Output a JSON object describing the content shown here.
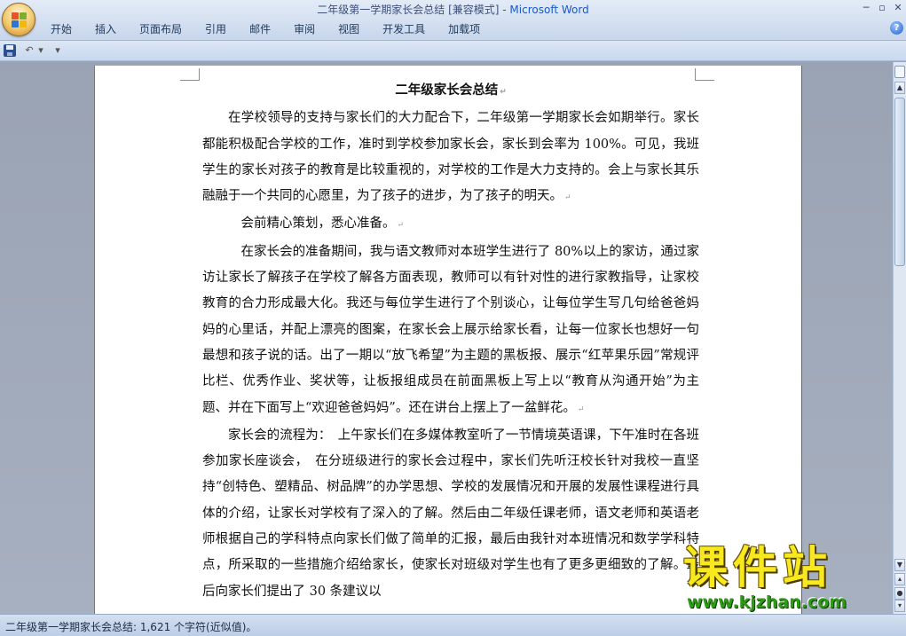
{
  "window": {
    "title_doc": "二年级第一学期家长会总结 [兼容模式] - ",
    "title_app": "Microsoft Word",
    "controls": [
      "─",
      "▫",
      "✕"
    ]
  },
  "ribbon": {
    "tabs": [
      "开始",
      "插入",
      "页面布局",
      "引用",
      "邮件",
      "审阅",
      "视图",
      "开发工具",
      "加载项"
    ],
    "help": "?"
  },
  "qat": {
    "undo": "↶",
    "undo_drop": "▾",
    "customize": "▾"
  },
  "document": {
    "heading": "二年级家长会总结",
    "paragraphs": [
      "在学校领导的支持与家长们的大力配合下，二年级第一学期家长会如期举行。家长都能积极配合学校的工作，准时到学校参加家长会，家长到会率为 100%。可见，我班学生的家长对孩子的教育是比较重视的，对学校的工作是大力支持的。会上与家长其乐融融于一个共同的心愿里，为了孩子的进步，为了孩子的明天。",
      "会前精心策划，悉心准备。",
      "在家长会的准备期间，我与语文教师对本班学生进行了 80%以上的家访，通过家访让家长了解孩子在学校了解各方面表现，教师可以有针对性的进行家教指导，让家校教育的合力形成最大化。我还与每位学生进行了个别谈心，让每位学生写几句给爸爸妈妈的心里话，并配上漂亮的图案，在家长会上展示给家长看，让每一位家长也想好一句最想和孩子说的话。出了一期以“放飞希望”为主题的黑板报、展示“红苹果乐园”常规评比栏、优秀作业、奖状等，让板报组成员在前面黑板上写上以“教育从沟通开始”为主题、并在下面写上“欢迎爸爸妈妈”。还在讲台上摆上了一盆鲜花。",
      "家长会的流程为：　上午家长们在多媒体教室听了一节情境英语课，下午准时在各班参加家长座谈会，　在分班级进行的家长会过程中，家长们先听汪校长针对我校一直坚持“创特色、塑精品、树品牌”的办学思想、学校的发展情况和开展的发展性课程进行具体的介绍，让家长对学校有了深入的了解。然后由二年级任课老师，语文老师和英语老师根据自己的学科特点向家长们做了简单的汇报，最后由我针对本班情况和数学学科特点，所采取的一些措施介绍给家长，使家长对班级对学生也有了更多更细致的了解。最后向家长们提出了 30 条建议以"
    ],
    "paragraph_mark": "↵"
  },
  "status": {
    "text": "二年级第一学期家长会总结: 1,621 个字符(近似值)。"
  },
  "watermark": {
    "title": "课件站",
    "url": "www.kjzhan.com"
  },
  "colors": {
    "title_app": "#1b58c6",
    "watermark_yellow": "#f7e820",
    "watermark_green": "#2f9a18"
  }
}
